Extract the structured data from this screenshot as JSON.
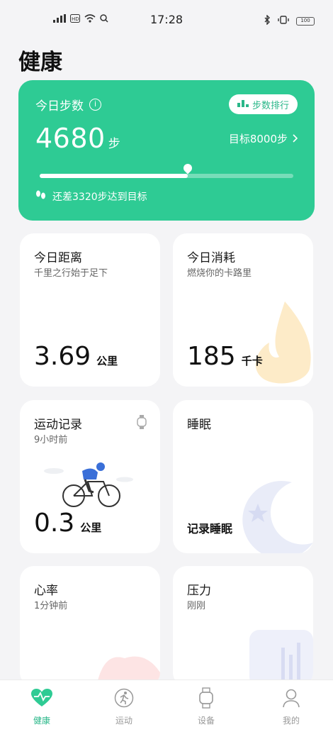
{
  "status_bar": {
    "time": "17:28",
    "battery": "100"
  },
  "page_title": "健康",
  "steps": {
    "title": "今日步数",
    "rank_label": "步数排行",
    "value": "4680",
    "unit": "步",
    "goal_label": "目标8000步",
    "progress": 0.585,
    "remaining_label": "还差3320步达到目标",
    "colors": {
      "card": "#2ecb94"
    }
  },
  "cards": {
    "distance": {
      "title": "今日距离",
      "subtitle": "千里之行始于足下",
      "value": "3.69",
      "unit": "公里"
    },
    "calories": {
      "title": "今日消耗",
      "subtitle": "燃烧你的卡路里",
      "value": "185",
      "unit": "千卡"
    },
    "workout": {
      "title": "运动记录",
      "subtitle": "9小时前",
      "value": "0.3",
      "unit": "公里"
    },
    "sleep": {
      "title": "睡眠",
      "action": "记录睡眠"
    },
    "heart": {
      "title": "心率",
      "subtitle": "1分钟前"
    },
    "stress": {
      "title": "压力",
      "subtitle": "刚刚"
    }
  },
  "tabs": [
    {
      "label": "健康",
      "icon": "heart-icon"
    },
    {
      "label": "运动",
      "icon": "run-icon"
    },
    {
      "label": "设备",
      "icon": "watch-icon"
    },
    {
      "label": "我的",
      "icon": "user-icon"
    }
  ]
}
